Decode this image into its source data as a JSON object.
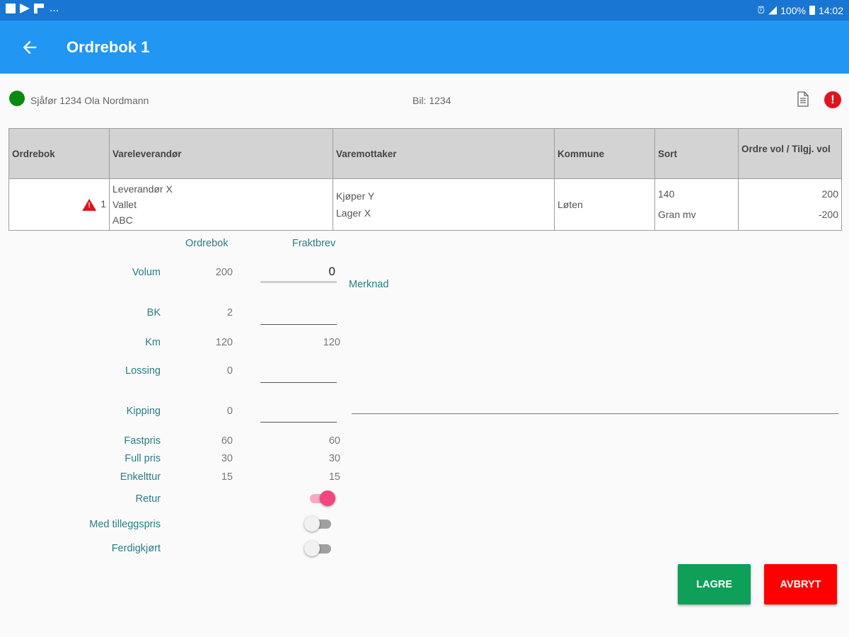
{
  "statusbar": {
    "more": "...",
    "battery": "100%",
    "time": "14:02"
  },
  "appbar": {
    "title": "Ordrebok 1"
  },
  "info": {
    "driver": "Sjåfør 1234 Ola Nordmann",
    "vehicle": "Bil: 1234",
    "status_color": "#0a8a12"
  },
  "table": {
    "headers": [
      "Ordrebok",
      "Vareleverandør",
      "Varemottaker",
      "Kommune",
      "Sort",
      "Ordre vol / Tilgj. vol"
    ],
    "row": {
      "ordrebok": "1",
      "warning_mark": "!",
      "vareleverandor": [
        "Leverandør X",
        "Vallet",
        "ABC"
      ],
      "varemottaker": [
        "Kjøper Y",
        "Lager X"
      ],
      "kommune": "Løten",
      "sort": [
        "140",
        "Gran mv"
      ],
      "vol": [
        "200",
        "-200"
      ]
    }
  },
  "form": {
    "col_ordrebok": "Ordrebok",
    "col_fraktbrev": "Fraktbrev",
    "merknad_label": "Merknad",
    "rows": [
      {
        "label": "Volum",
        "ordrebok": "200",
        "fraktbrev": "0"
      },
      {
        "label": "BK",
        "ordrebok": "2",
        "fraktbrev": ""
      },
      {
        "label": "Km",
        "ordrebok": "120",
        "fraktbrev": "120"
      },
      {
        "label": "Lossing",
        "ordrebok": "0",
        "fraktbrev": ""
      },
      {
        "label": "Kipping",
        "ordrebok": "0",
        "fraktbrev": ""
      },
      {
        "label": "Fastpris",
        "ordrebok": "60",
        "fraktbrev": "60"
      },
      {
        "label": "Full pris",
        "ordrebok": "30",
        "fraktbrev": "30"
      },
      {
        "label": "Enkelttur",
        "ordrebok": "15",
        "fraktbrev": "15"
      }
    ],
    "toggles": [
      {
        "label": "Retur",
        "on": true
      },
      {
        "label": "Med tilleggspris",
        "on": false
      },
      {
        "label": "Ferdigkjørt",
        "on": false
      }
    ]
  },
  "buttons": {
    "save": "LAGRE",
    "cancel": "AVBRYT",
    "save_color": "#0e9f59",
    "cancel_color": "#ff0000"
  },
  "colors": {
    "statusbar": "#1976d2",
    "appbar": "#2196f3",
    "label": "#277e87",
    "toggle_on": "#f0477f"
  }
}
